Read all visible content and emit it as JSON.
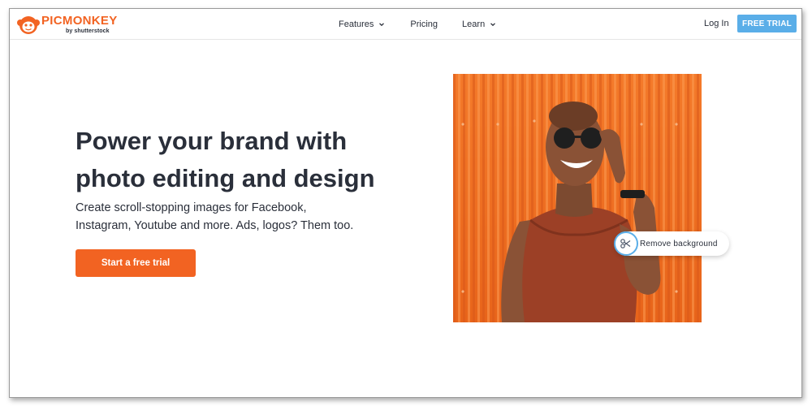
{
  "brand": {
    "name": "PICMONKEY",
    "byline": "by shutterstock",
    "accent": "#f26322",
    "cta_blue": "#5aaee8"
  },
  "nav": {
    "items": [
      {
        "label": "Features",
        "has_dropdown": true
      },
      {
        "label": "Pricing",
        "has_dropdown": false
      },
      {
        "label": "Learn",
        "has_dropdown": true
      }
    ],
    "login_label": "Log In",
    "trial_label": "FREE TRIAL"
  },
  "hero": {
    "headline_line1": "Power your brand with",
    "headline_line2": "photo editing and design",
    "subline_line1": "Create scroll-stopping images for Facebook,",
    "subline_line2": "Instagram, Youtube and more. Ads, logos? Them too.",
    "cta_label": "Start a free trial"
  },
  "photo": {
    "badge_label": "Remove background",
    "badge_icon": "scissors-icon"
  }
}
